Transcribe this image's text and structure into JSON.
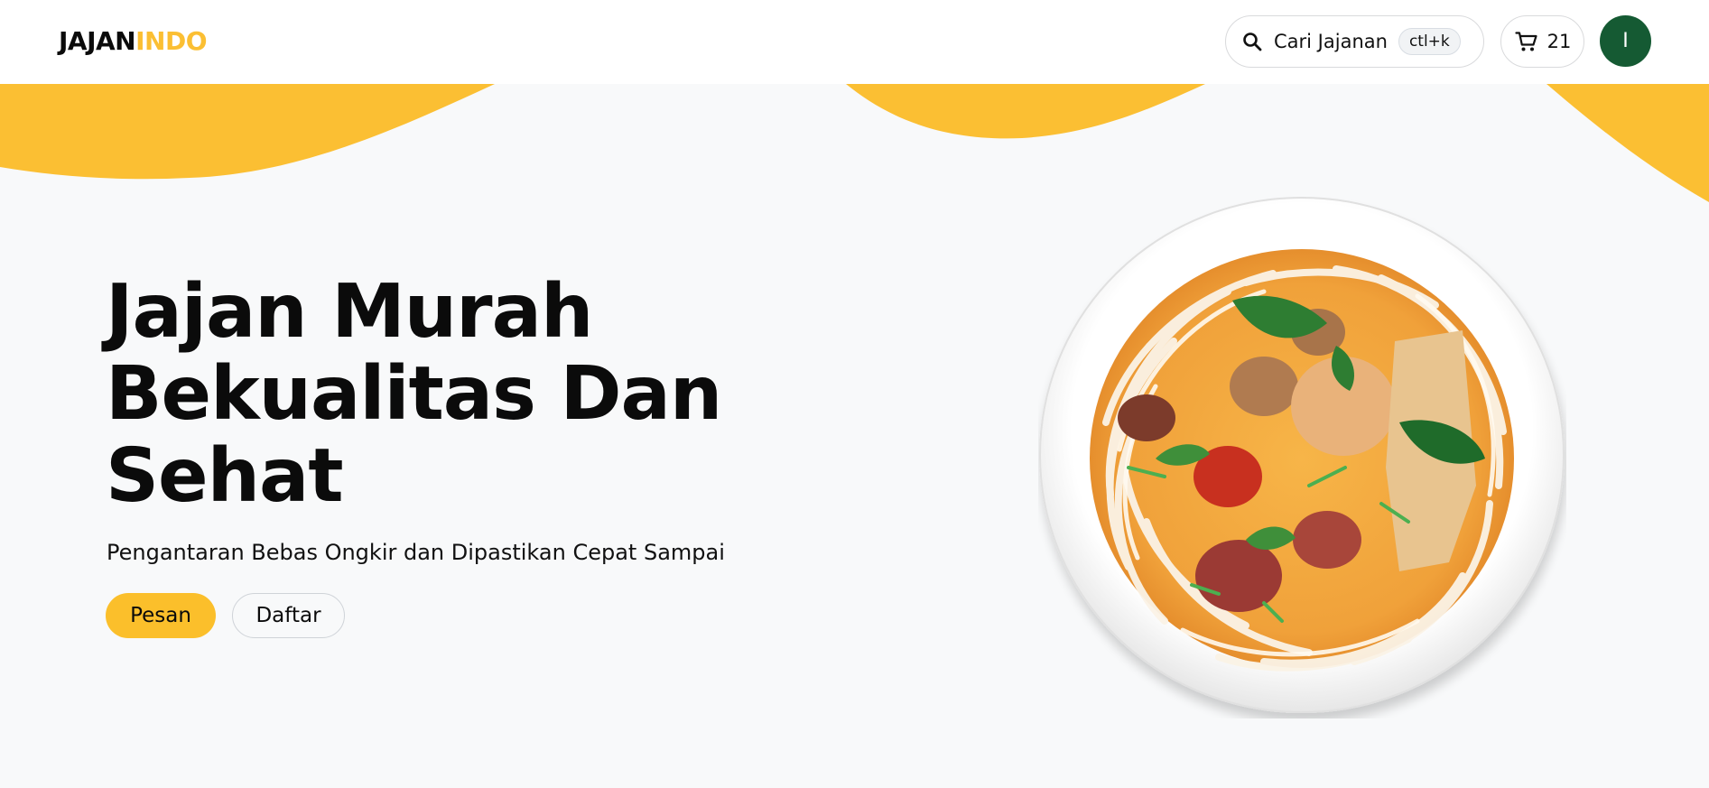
{
  "header": {
    "logo_part1": "JAJAN",
    "logo_part2": "INDO",
    "search_label": "Cari Jajanan",
    "search_shortcut": "ctl+k",
    "cart_count": "21",
    "avatar_initial": "I",
    "search_icon": "search-icon",
    "cart_icon": "cart-icon"
  },
  "hero": {
    "title_line1": "Jajan Murah",
    "title_line2": "Bekualitas Dan",
    "title_line3": "Sehat",
    "subtitle": "Pengantaran Bebas Ongkir dan Dipastikan Cepat Sampai",
    "primary_button": "Pesan",
    "secondary_button": "Daftar",
    "image": "noodle-soup-bowl"
  },
  "colors": {
    "accent": "#fbbf33",
    "background": "#f8f9fa",
    "avatar_bg": "#155a33",
    "text": "#0b0b0b"
  }
}
